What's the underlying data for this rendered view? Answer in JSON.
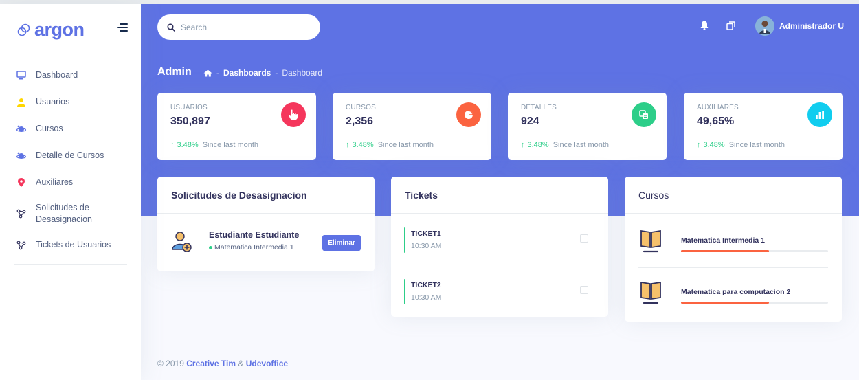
{
  "brand": {
    "name": "argon"
  },
  "sidebar": {
    "items": [
      {
        "label": "Dashboard",
        "icon": "monitor-icon",
        "color": "#5e72e4"
      },
      {
        "label": "Usuarios",
        "icon": "user-icon",
        "color": "#ffd600"
      },
      {
        "label": "Cursos",
        "icon": "planet-icon",
        "color": "#5e72e4"
      },
      {
        "label": "Detalle de Cursos",
        "icon": "planet-icon",
        "color": "#5e72e4"
      },
      {
        "label": "Auxiliares",
        "icon": "pin-icon",
        "color": "#f5365c"
      },
      {
        "label": "Solicitudes de Desasignacion",
        "icon": "molecule-icon",
        "color": "#32325d"
      },
      {
        "label": "Tickets de Usuarios",
        "icon": "molecule-icon",
        "color": "#32325d"
      }
    ]
  },
  "header": {
    "search_placeholder": "Search",
    "user_name": "Administrador U",
    "page_title": "Admin",
    "breadcrumb": [
      "Dashboards",
      "Dashboard"
    ]
  },
  "stats": [
    {
      "title": "USUARIOS",
      "value": "350,897",
      "change": "3.48%",
      "since": "Since last month",
      "icon": "hand-pointer-icon",
      "color": "#f5365c"
    },
    {
      "title": "CURSOS",
      "value": "2,356",
      "change": "3.48%",
      "since": "Since last month",
      "icon": "pie-chart-icon",
      "color": "#fb6340"
    },
    {
      "title": "DETALLES",
      "value": "924",
      "change": "3.48%",
      "since": "Since last month",
      "icon": "copy-icon",
      "color": "#2dce89"
    },
    {
      "title": "AUXILIARES",
      "value": "49,65%",
      "change": "3.48%",
      "since": "Since last month",
      "icon": "bar-chart-icon",
      "color": "#11cdef"
    }
  ],
  "solicitudes": {
    "title": "Solicitudes de Desasignacion",
    "item": {
      "name": "Estudiante Estudiante",
      "course": "Matematica Intermedia 1",
      "button": "Eliminar"
    }
  },
  "tickets": {
    "title": "Tickets",
    "items": [
      {
        "name": "TICKET1",
        "time": "10:30 AM"
      },
      {
        "name": "TICKET2",
        "time": "10:30 AM"
      }
    ]
  },
  "cursos": {
    "title": "Cursos",
    "items": [
      {
        "name": "Matematica Intermedia 1",
        "progress": 0.6
      },
      {
        "name": "Matematica para computacion 2",
        "progress": 0.6
      }
    ]
  },
  "footer": {
    "year": "© 2019",
    "author1": "Creative Tim",
    "amp": "&",
    "author2": "Udevoffice"
  }
}
